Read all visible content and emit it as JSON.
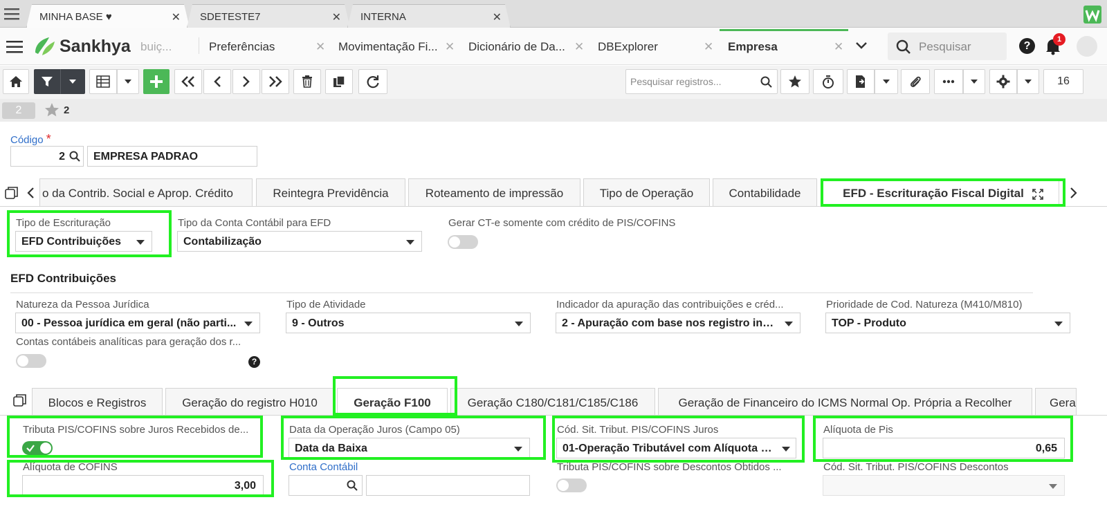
{
  "browser_tabs": [
    {
      "label": "MINHA BASE ♥"
    },
    {
      "label": "SDETESTE7"
    },
    {
      "label": "INTERNA"
    }
  ],
  "header": {
    "brand": "Sankhya",
    "tabs": [
      {
        "label": "buiç..."
      },
      {
        "label": "Preferências"
      },
      {
        "label": "Movimentação Fi..."
      },
      {
        "label": "Dicionário de Da..."
      },
      {
        "label": "DBExplorer"
      },
      {
        "label": "Empresa"
      }
    ],
    "search_placeholder": "Pesquisar",
    "notifications_count": "1"
  },
  "toolbar": {
    "search_placeholder": "Pesquisar registros...",
    "page_size": "16"
  },
  "status": {
    "record_badge": "2",
    "favorite_count": "2"
  },
  "form": {
    "codigo_label": "Código",
    "required_mark": "*",
    "codigo_value": "2",
    "empresa_name": "EMPRESA PADRAO"
  },
  "top_tabs": [
    {
      "label": "o da Contrib. Social e Aprop. Crédito"
    },
    {
      "label": "Reintegra Previdência"
    },
    {
      "label": "Roteamento de impressão"
    },
    {
      "label": "Tipo de Operação"
    },
    {
      "label": "Contabilidade"
    },
    {
      "label": "EFD - Escrituração Fiscal Digital"
    }
  ],
  "efd": {
    "tipo_escrituracao_label": "Tipo de Escrituração",
    "tipo_escrituracao_value": "EFD Contribuições",
    "tipo_conta_label": "Tipo da Conta Contábil para EFD",
    "tipo_conta_value": "Contabilização",
    "gerar_cte_label": "Gerar CT-e somente com crédito de PIS/COFINS",
    "section_title": "EFD Contribuições",
    "natureza_label": "Natureza da Pessoa Jurídica",
    "natureza_value": "00 - Pessoa jurídica em geral (não parti...",
    "tipo_atividade_label": "Tipo de Atividade",
    "tipo_atividade_value": "9 - Outros",
    "indicador_label": "Indicador da apuração das contribuições e créd...",
    "indicador_value": "2 - Apuração com base nos registro indi...",
    "prioridade_label": "Prioridade de Cod. Natureza (M410/M810)",
    "prioridade_value": "TOP - Produto",
    "contas_label": "Contas contábeis analíticas para geração dos r..."
  },
  "sub_tabs": [
    {
      "label": "Blocos e Registros"
    },
    {
      "label": "Geração do registro H010"
    },
    {
      "label": "Geração F100"
    },
    {
      "label": "Geração C180/C181/C185/C186"
    },
    {
      "label": "Geração de Financeiro do ICMS Normal Op. Própria a Recolher"
    },
    {
      "label": "Gera"
    }
  ],
  "f100": {
    "tributa_juros_label": "Tributa PIS/COFINS sobre Juros Recebidos de...",
    "data_operacao_label": "Data da Operação Juros (Campo 05)",
    "data_operacao_value": "Data da Baixa",
    "cod_sit_juros_label": "Cód. Sit. Tribut. PIS/COFINS Juros",
    "cod_sit_juros_value": "01-Operação Tributável com Alíquota B...",
    "aliquota_pis_label": "Alíquota de Pis",
    "aliquota_pis_value": "0,65",
    "aliquota_cofins_label": "Alíquota de COFINS",
    "aliquota_cofins_value": "3,00",
    "conta_contabil_label": "Conta Contábil",
    "tributa_descontos_label": "Tributa PIS/COFINS sobre Descontos Obtidos ...",
    "cod_sit_descontos_label": "Cód. Sit. Tribut. PIS/COFINS Descontos"
  },
  "colors": {
    "highlight": "#22f022",
    "toggle_on": "#3aa745",
    "link_blue": "#2f6ec9",
    "brand_green": "#4cb857"
  }
}
